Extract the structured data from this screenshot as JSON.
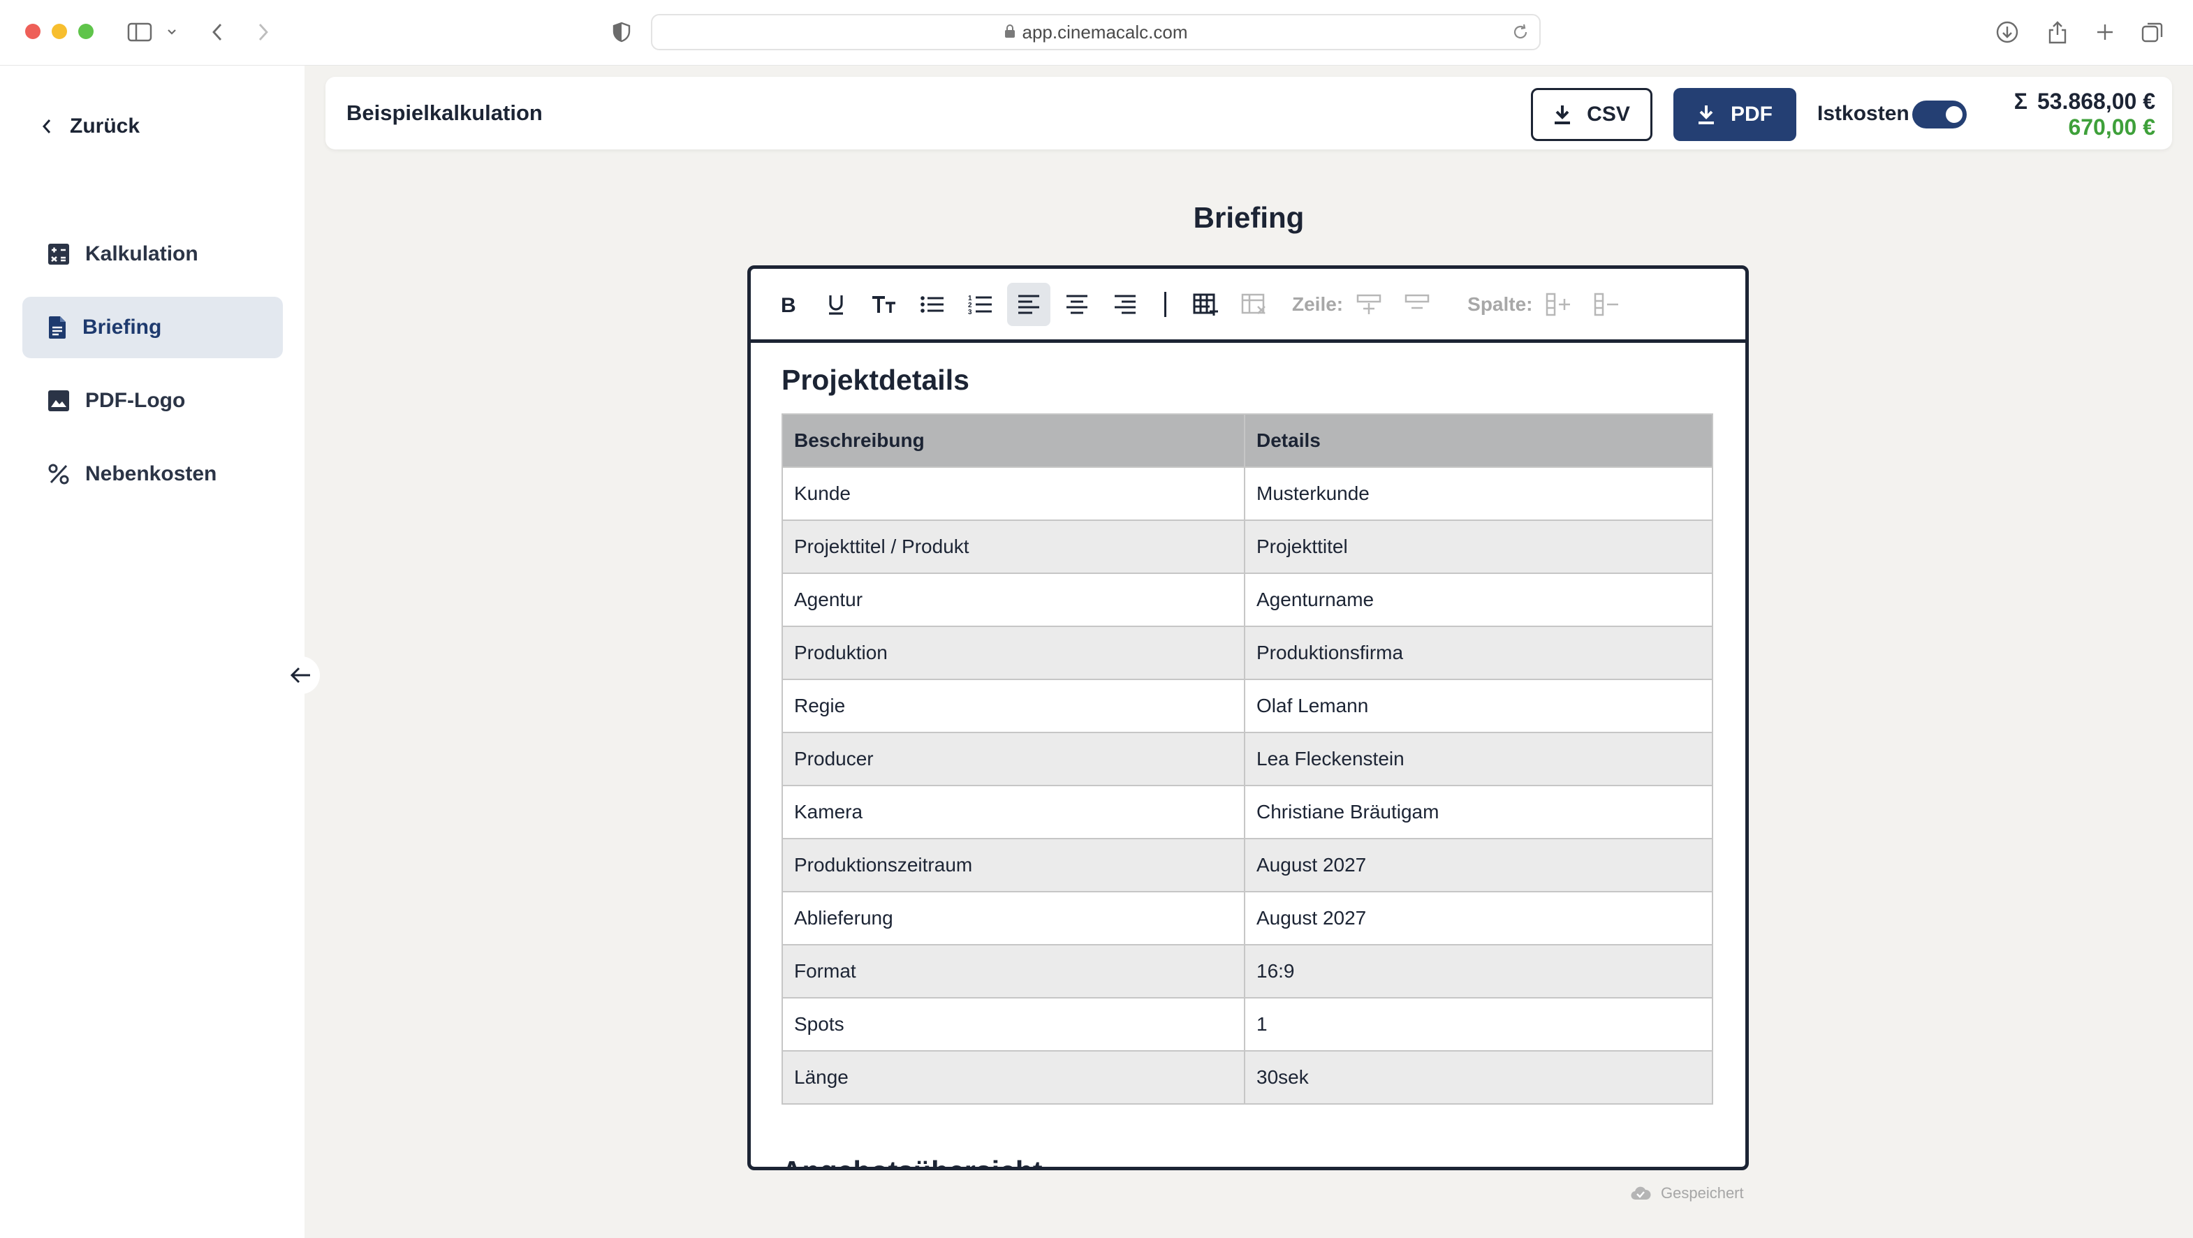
{
  "browser": {
    "url": "app.cinemacalc.com"
  },
  "sidebar": {
    "back_label": "Zurück",
    "items": [
      {
        "label": "Kalkulation",
        "icon": "calculator-icon"
      },
      {
        "label": "Briefing",
        "icon": "document-icon",
        "active": true
      },
      {
        "label": "PDF-Logo",
        "icon": "image-icon"
      },
      {
        "label": "Nebenkosten",
        "icon": "percent-icon"
      }
    ]
  },
  "header": {
    "title": "Beispielkalkulation",
    "csv_label": "CSV",
    "pdf_label": "PDF",
    "istkosten_label": "Istkosten",
    "istkosten_on": true,
    "sum_symbol": "Σ",
    "total": "53.868,00 €",
    "ist_total": "670,00 €",
    "colors": {
      "accent": "#243f73",
      "positive": "#3ea03a"
    }
  },
  "main": {
    "title": "Briefing"
  },
  "editor": {
    "toolbar": {
      "row_label": "Zeile:",
      "column_label": "Spalte:"
    },
    "heading": "Projektdetails",
    "table": {
      "headers": [
        "Beschreibung",
        "Details"
      ],
      "rows": [
        [
          "Kunde",
          "Musterkunde"
        ],
        [
          "Projekttitel / Produkt",
          "Projekttitel"
        ],
        [
          "Agentur",
          "Agenturname"
        ],
        [
          "Produktion",
          "Produktionsfirma"
        ],
        [
          "Regie",
          "Olaf Lemann"
        ],
        [
          "Producer",
          "Lea Fleckenstein"
        ],
        [
          "Kamera",
          "Christiane Bräutigam"
        ],
        [
          "Produktionszeitraum",
          "August 2027"
        ],
        [
          "Ablieferung",
          "August 2027"
        ],
        [
          "Format",
          "16:9"
        ],
        [
          "Spots",
          "1"
        ],
        [
          "Länge",
          "30sek"
        ]
      ]
    },
    "next_heading": "Angebotsübersicht"
  },
  "status": {
    "saved_label": "Gespeichert"
  }
}
